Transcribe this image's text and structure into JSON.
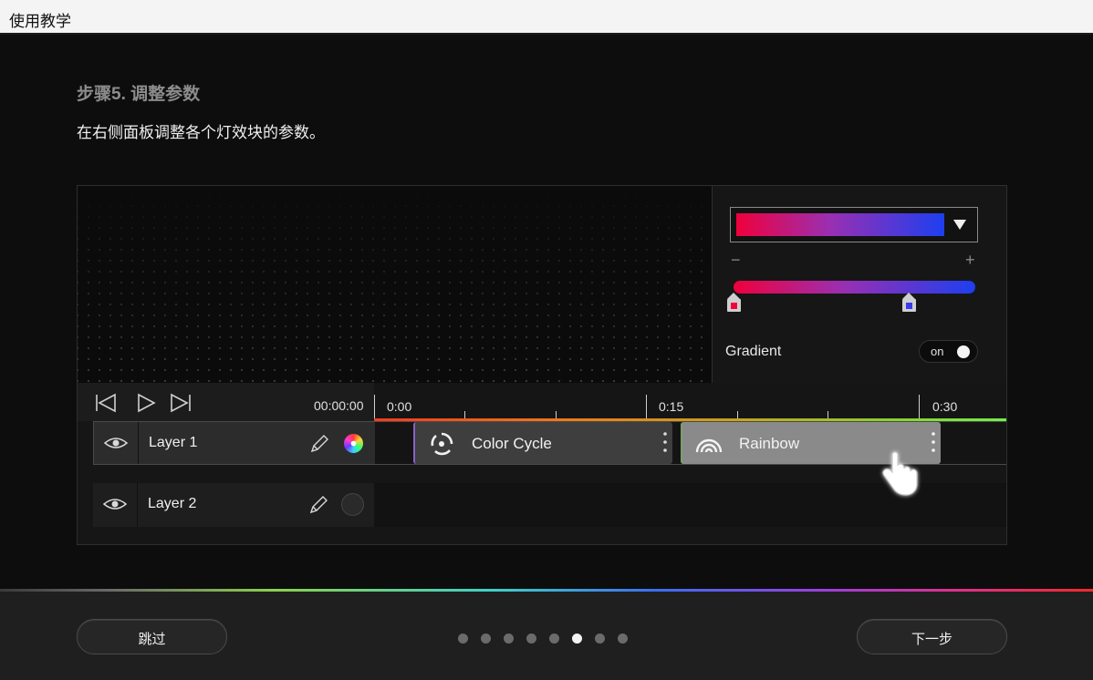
{
  "window": {
    "title": "使用教学"
  },
  "step": {
    "title": "步骤5. 调整参数",
    "description": "在右侧面板调整各个灯效块的参数。"
  },
  "panel": {
    "gradient_colors": [
      "#f0003c",
      "#9a2fb2",
      "#1d3ff0"
    ],
    "stop_colors": [
      "#f0003c",
      "#3a3af0"
    ],
    "minus_label": "−",
    "plus_label": "+",
    "gradient_label": "Gradient",
    "toggle_label": "on",
    "toggle_state": true
  },
  "timeline": {
    "timecode": "00:00:00",
    "ticks": [
      "0:00",
      "0:15",
      "0:30"
    ],
    "controls": [
      "skip-back-icon",
      "play-icon",
      "skip-forward-icon"
    ]
  },
  "layers": [
    {
      "name": "Layer 1",
      "effects": [
        {
          "name": "Color Cycle",
          "icon": "color-cycle-icon"
        },
        {
          "name": "Rainbow",
          "icon": "rainbow-icon"
        }
      ]
    },
    {
      "name": "Layer 2",
      "effects": []
    }
  ],
  "footer": {
    "skip_label": "跳过",
    "next_label": "下一步",
    "page_count": 8,
    "active_page": 6
  }
}
